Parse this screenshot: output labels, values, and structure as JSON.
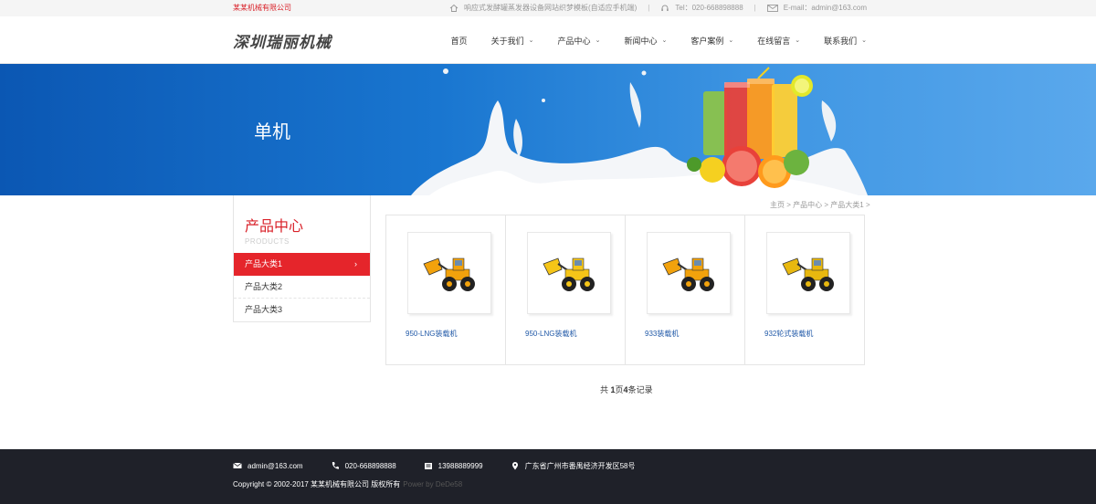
{
  "topbar": {
    "company": "某某机械有限公司",
    "slogan": "响应式发酵罐蒸发器设备网站织梦模板(自适应手机端)",
    "tel": "Tel：020-668898888",
    "email": "E-mail：admin@163.com"
  },
  "header": {
    "logo": "深圳瑞丽机械",
    "nav": [
      "首页",
      "关于我们",
      "产品中心",
      "新闻中心",
      "客户案例",
      "在线留言",
      "联系我们"
    ]
  },
  "banner": {
    "title": "单机"
  },
  "sidebar": {
    "title": "产品中心",
    "subtitle": "PRODUCTS",
    "items": [
      "产品大类1",
      "产品大类2",
      "产品大类3"
    ],
    "active_arrow": "›"
  },
  "breadcrumb": {
    "home": "主页",
    "sep": ">",
    "level1": "产品中心",
    "level2": "产品大类1",
    "tail": ">"
  },
  "products": [
    {
      "name": "950-LNG装载机",
      "color": "#f2a20c"
    },
    {
      "name": "950-LNG装载机",
      "color": "#f5c518"
    },
    {
      "name": "933装载机",
      "color": "#f2a20c"
    },
    {
      "name": "932轮式装载机",
      "color": "#e8b80f"
    }
  ],
  "pager": {
    "prefix": "共 ",
    "pages": "1",
    "mid": "页",
    "records": "4",
    "suffix": "条记录"
  },
  "footer": {
    "email": "admin@163.com",
    "phone": "020-668898888",
    "mobile": "13988889999",
    "address": "广东省广州市番禺经济开发区58号",
    "copyright": "Copyright © 2002-2017 某某机械有限公司 版权所有",
    "power": "Power by DeDe58"
  },
  "colors": {
    "accent": "#e5252b",
    "link": "#225aa8",
    "footer_bg": "#1f2129"
  }
}
